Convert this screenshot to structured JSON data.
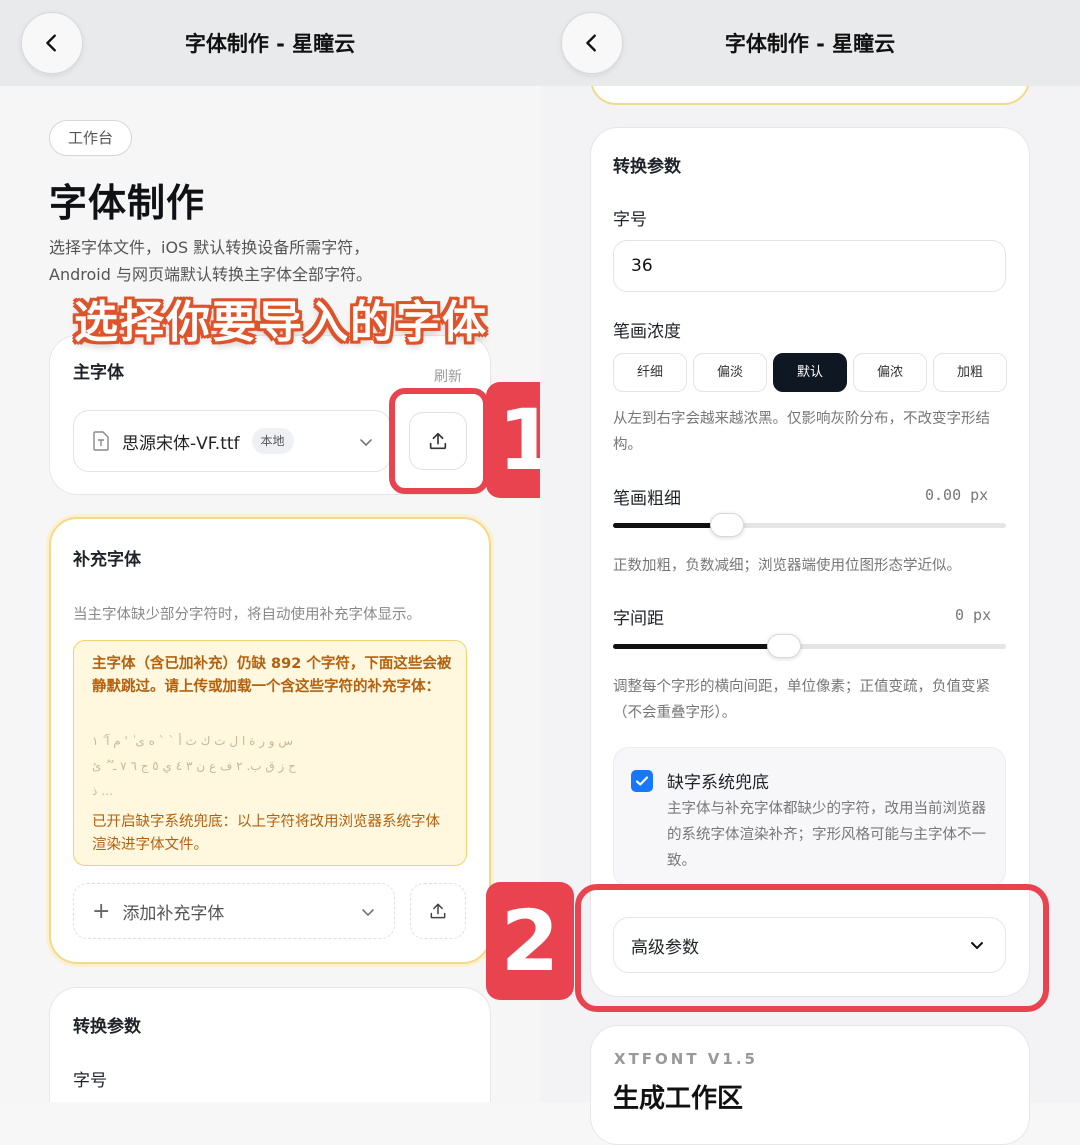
{
  "header": {
    "title": "字体制作 - 星瞳云"
  },
  "left": {
    "breadcrumb": "工作台",
    "page_title": "字体制作",
    "description_line1": "选择字体文件，iOS 默认转换设备所需字符，",
    "description_line2": "Android 与网页端默认转换主字体全部字符。",
    "annotation_title": "选择你要导入的字体",
    "annotation_number": "1",
    "main_font": {
      "title": "主字体",
      "refresh": "刷新",
      "file_name": "思源宋体-VF.ttf",
      "badge": "本地"
    },
    "supplement": {
      "title": "补充字体",
      "description": "当主字体缺少部分字符时，将自动使用补充字体显示。",
      "warning_text": "主字体（含已加补充）仍缺 892 个字符，下面这些会被静默跳过。请上传或加载一个含这些字符的补充字体：",
      "glyphs_line1": "س و ر ة ا ل ت ك ث أ ` ` ه ى ٰ ' م آ ً ١",
      "glyphs_line2": "ح ز ق ب. ٢ ف ع ن ٣ ٤ ي ٥ ج ٦ ٧ ـ ٌ ُ ئ",
      "glyphs_line3": "ذ …",
      "fallback_text": "已开启缺字系统兜底：以上字符将改用浏览器系统字体渲染进字体文件。",
      "add_label": "添加补充字体"
    },
    "conversion": {
      "title": "转换参数",
      "font_size_label": "字号"
    }
  },
  "right": {
    "conversion": {
      "title": "转换参数",
      "font_size_label": "字号",
      "font_size_value": "36",
      "stroke_density_label": "笔画浓度",
      "density_options": [
        "纤细",
        "偏淡",
        "默认",
        "偏浓",
        "加粗"
      ],
      "density_hint": "从左到右字会越来越浓黑。仅影响灰阶分布，不改变字形结构。",
      "stroke_width_label": "笔画粗细",
      "stroke_width_value": "0.00 px",
      "stroke_width_hint": "正数加粗，负数减细；浏览器端使用位图形态学近似。",
      "letter_spacing_label": "字间距",
      "letter_spacing_value": "0 px",
      "letter_spacing_hint": "调整每个字形的横向间距，单位像素；正值变疏，负值变紧（不会重叠字形）。",
      "fallback_title": "缺字系统兜底",
      "fallback_desc": "主字体与补充字体都缺少的字符，改用当前浏览器的系统字体渲染补齐；字形风格可能与主字体不一致。",
      "advanced_label": "高级参数"
    },
    "annotation_number": "2",
    "brand_version": "XTFONT V1.5",
    "workspace_title": "生成工作区"
  },
  "colors": {
    "accent": "#1677ff",
    "annotation_red": "#e8434f",
    "annotation_orange": "#e0532a",
    "warning_text": "#b4610f",
    "warning_bg": "#fff8df",
    "active_segment": "#0f1722"
  }
}
